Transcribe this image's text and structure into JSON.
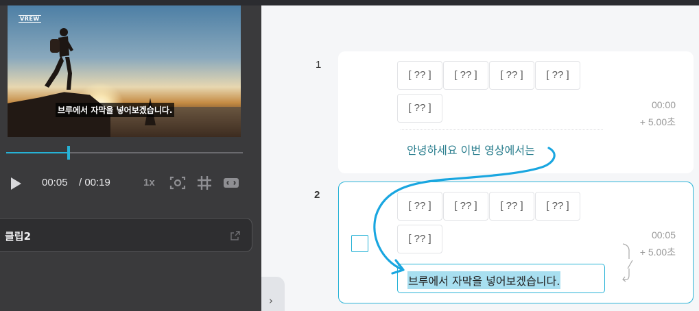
{
  "player": {
    "watermark": "VREW",
    "subtitle": "브루에서 자막을 넣어보겠습니다.",
    "current_time": "00:05",
    "total_time": "/ 00:19",
    "progress": 0.263,
    "speed": "1x"
  },
  "clip_panel": {
    "label": "클립2"
  },
  "rows": [
    {
      "number": "1",
      "tokens": [
        "[ ?? ]",
        "[ ?? ]",
        "[ ?? ]",
        "[ ?? ]",
        "[ ?? ]"
      ],
      "text": "안녕하세요  이번  영상에서는",
      "start": "00:00",
      "duration": "+  5.00초"
    },
    {
      "number": "2",
      "tokens": [
        "[ ?? ]",
        "[ ?? ]",
        "[ ?? ]",
        "[ ?? ]",
        "[ ?? ]"
      ],
      "text": "브루에서  자막을  넣어보겠습니다.",
      "start": "00:05",
      "duration": "+  5.00초"
    }
  ],
  "colors": {
    "accent": "#26b2d6",
    "panel_dark": "#3a3a3c",
    "subtitle_text": "#2c7f8f"
  },
  "icons": [
    "play-icon",
    "screenshot-icon",
    "grid-icon",
    "subtitle-toggle-icon",
    "external-link-icon",
    "chevron-right-icon"
  ]
}
